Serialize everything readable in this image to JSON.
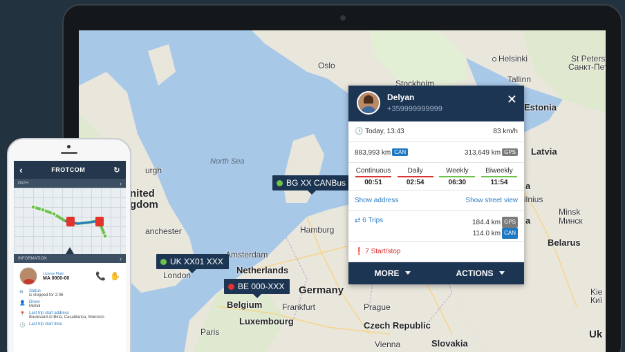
{
  "map": {
    "labels": {
      "helsinki": "Helsinki",
      "st_petersburg": "St Peters",
      "st_petersburg_ru": "Санкт-Пете",
      "oslo": "Oslo",
      "stockholm": "Stockholm",
      "tallinn": "Tallinn",
      "estonia": "Estonia",
      "latvia": "Latvia",
      "north_sea": "North Sea",
      "united_kingdom_1": "nited",
      "united_kingdom_2": "gdom",
      "burgh": "urgh",
      "manchester": "anchester",
      "london": "London",
      "hamburg": "Hamburg",
      "amsterdam": "Amsterdam",
      "netherlands": "Netherlands",
      "germany": "Germany",
      "belgium": "Belgium",
      "frankfurt": "Frankfurt",
      "luxembourg": "Luxembourg",
      "prague": "Prague",
      "czech_republic": "Czech Republic",
      "paris": "Paris",
      "vienna": "Vienna",
      "slovakia": "Slovakia",
      "minsk": "Minsk",
      "minsk_ru": "Минск",
      "belarus": "Belarus",
      "vilnius": "ilnius",
      "kiev": "Kie",
      "kiev_ru": "Киї",
      "ukraine": "Uk",
      "a_fragment_1": "a",
      "a_fragment_2": "a"
    },
    "vehicles": [
      {
        "label": "BG XX CANBus",
        "status_color": "#6cc24a"
      },
      {
        "label": "UK XX01 XXX",
        "status_color": "#6cc24a"
      },
      {
        "label": "BE 000-XXX",
        "status_color": "#e2332d"
      }
    ]
  },
  "popup": {
    "driver_name": "Delyan",
    "driver_phone": "+359999999999",
    "close_glyph": "✕",
    "time_icon": "🕓",
    "time": "Today, 13:43",
    "speed": "83 km/h",
    "odometer_can": "883,993 km",
    "odometer_gps": "313,649 km",
    "badge_can": "CAN",
    "badge_gps": "GPS",
    "times": [
      {
        "label": "Continuous",
        "value": "00:51",
        "bar_color": "#d9322c"
      },
      {
        "label": "Daily",
        "value": "02:54",
        "bar_color": "#d9322c"
      },
      {
        "label": "Weekly",
        "value": "06:30",
        "bar_color": "#6cc24a"
      },
      {
        "label": "Biweekly",
        "value": "11:54",
        "bar_color": "#6cc24a"
      }
    ],
    "show_address": "Show address",
    "show_street_view": "Show street view",
    "trips_icon": "⇄",
    "trips": "6 Trips",
    "trip_km_gps": "184.4 km",
    "trip_km_can": "114.0 km",
    "startstop_icon": "❗",
    "startstop": "7 Start/stop",
    "more": "MORE",
    "actions": "ACTIONS"
  },
  "phone": {
    "back": "‹",
    "title": "FROTCOM",
    "refresh": "↻",
    "path_label": "PATH",
    "info_label": "INFORMATION",
    "chevron": "›",
    "license_label": "License Plate",
    "license_value": "MA 0000-00",
    "call_icon": "📞",
    "stop_icon": "✋",
    "items": [
      {
        "icon": "⊖",
        "key": "Status",
        "value": "is stopped for 2:06"
      },
      {
        "icon": "👤",
        "key": "Driver",
        "value": "Mehdi"
      },
      {
        "icon": "📍",
        "key": "Last trip start address",
        "value": "Boulevard Al Bina, Casablanca, Morocco"
      },
      {
        "icon": "🕓",
        "key": "Last trip start time",
        "value": ""
      }
    ]
  },
  "colors": {
    "navy": "#1c3552",
    "link_blue": "#2d7bc4",
    "alert_red": "#d42a2a",
    "status_green": "#6cc24a"
  }
}
